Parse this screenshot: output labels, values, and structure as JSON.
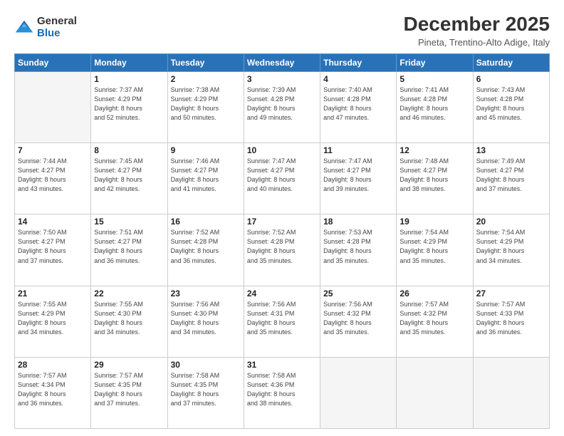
{
  "logo": {
    "general": "General",
    "blue": "Blue"
  },
  "title": "December 2025",
  "subtitle": "Pineta, Trentino-Alto Adige, Italy",
  "headers": [
    "Sunday",
    "Monday",
    "Tuesday",
    "Wednesday",
    "Thursday",
    "Friday",
    "Saturday"
  ],
  "weeks": [
    [
      {
        "day": "",
        "info": ""
      },
      {
        "day": "1",
        "info": "Sunrise: 7:37 AM\nSunset: 4:29 PM\nDaylight: 8 hours\nand 52 minutes."
      },
      {
        "day": "2",
        "info": "Sunrise: 7:38 AM\nSunset: 4:29 PM\nDaylight: 8 hours\nand 50 minutes."
      },
      {
        "day": "3",
        "info": "Sunrise: 7:39 AM\nSunset: 4:28 PM\nDaylight: 8 hours\nand 49 minutes."
      },
      {
        "day": "4",
        "info": "Sunrise: 7:40 AM\nSunset: 4:28 PM\nDaylight: 8 hours\nand 47 minutes."
      },
      {
        "day": "5",
        "info": "Sunrise: 7:41 AM\nSunset: 4:28 PM\nDaylight: 8 hours\nand 46 minutes."
      },
      {
        "day": "6",
        "info": "Sunrise: 7:43 AM\nSunset: 4:28 PM\nDaylight: 8 hours\nand 45 minutes."
      }
    ],
    [
      {
        "day": "7",
        "info": "Sunrise: 7:44 AM\nSunset: 4:27 PM\nDaylight: 8 hours\nand 43 minutes."
      },
      {
        "day": "8",
        "info": "Sunrise: 7:45 AM\nSunset: 4:27 PM\nDaylight: 8 hours\nand 42 minutes."
      },
      {
        "day": "9",
        "info": "Sunrise: 7:46 AM\nSunset: 4:27 PM\nDaylight: 8 hours\nand 41 minutes."
      },
      {
        "day": "10",
        "info": "Sunrise: 7:47 AM\nSunset: 4:27 PM\nDaylight: 8 hours\nand 40 minutes."
      },
      {
        "day": "11",
        "info": "Sunrise: 7:47 AM\nSunset: 4:27 PM\nDaylight: 8 hours\nand 39 minutes."
      },
      {
        "day": "12",
        "info": "Sunrise: 7:48 AM\nSunset: 4:27 PM\nDaylight: 8 hours\nand 38 minutes."
      },
      {
        "day": "13",
        "info": "Sunrise: 7:49 AM\nSunset: 4:27 PM\nDaylight: 8 hours\nand 37 minutes."
      }
    ],
    [
      {
        "day": "14",
        "info": "Sunrise: 7:50 AM\nSunset: 4:27 PM\nDaylight: 8 hours\nand 37 minutes."
      },
      {
        "day": "15",
        "info": "Sunrise: 7:51 AM\nSunset: 4:27 PM\nDaylight: 8 hours\nand 36 minutes."
      },
      {
        "day": "16",
        "info": "Sunrise: 7:52 AM\nSunset: 4:28 PM\nDaylight: 8 hours\nand 36 minutes."
      },
      {
        "day": "17",
        "info": "Sunrise: 7:52 AM\nSunset: 4:28 PM\nDaylight: 8 hours\nand 35 minutes."
      },
      {
        "day": "18",
        "info": "Sunrise: 7:53 AM\nSunset: 4:28 PM\nDaylight: 8 hours\nand 35 minutes."
      },
      {
        "day": "19",
        "info": "Sunrise: 7:54 AM\nSunset: 4:29 PM\nDaylight: 8 hours\nand 35 minutes."
      },
      {
        "day": "20",
        "info": "Sunrise: 7:54 AM\nSunset: 4:29 PM\nDaylight: 8 hours\nand 34 minutes."
      }
    ],
    [
      {
        "day": "21",
        "info": "Sunrise: 7:55 AM\nSunset: 4:29 PM\nDaylight: 8 hours\nand 34 minutes."
      },
      {
        "day": "22",
        "info": "Sunrise: 7:55 AM\nSunset: 4:30 PM\nDaylight: 8 hours\nand 34 minutes."
      },
      {
        "day": "23",
        "info": "Sunrise: 7:56 AM\nSunset: 4:30 PM\nDaylight: 8 hours\nand 34 minutes."
      },
      {
        "day": "24",
        "info": "Sunrise: 7:56 AM\nSunset: 4:31 PM\nDaylight: 8 hours\nand 35 minutes."
      },
      {
        "day": "25",
        "info": "Sunrise: 7:56 AM\nSunset: 4:32 PM\nDaylight: 8 hours\nand 35 minutes."
      },
      {
        "day": "26",
        "info": "Sunrise: 7:57 AM\nSunset: 4:32 PM\nDaylight: 8 hours\nand 35 minutes."
      },
      {
        "day": "27",
        "info": "Sunrise: 7:57 AM\nSunset: 4:33 PM\nDaylight: 8 hours\nand 36 minutes."
      }
    ],
    [
      {
        "day": "28",
        "info": "Sunrise: 7:57 AM\nSunset: 4:34 PM\nDaylight: 8 hours\nand 36 minutes."
      },
      {
        "day": "29",
        "info": "Sunrise: 7:57 AM\nSunset: 4:35 PM\nDaylight: 8 hours\nand 37 minutes."
      },
      {
        "day": "30",
        "info": "Sunrise: 7:58 AM\nSunset: 4:35 PM\nDaylight: 8 hours\nand 37 minutes."
      },
      {
        "day": "31",
        "info": "Sunrise: 7:58 AM\nSunset: 4:36 PM\nDaylight: 8 hours\nand 38 minutes."
      },
      {
        "day": "",
        "info": ""
      },
      {
        "day": "",
        "info": ""
      },
      {
        "day": "",
        "info": ""
      }
    ]
  ]
}
